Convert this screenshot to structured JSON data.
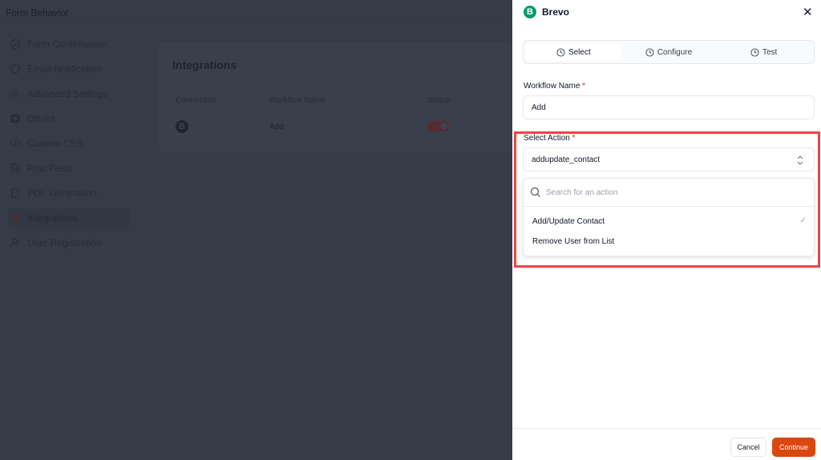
{
  "background": {
    "header_title": "Form Behavior",
    "sidebar": [
      {
        "label": "Form Confirmation",
        "icon": "check-circle-icon"
      },
      {
        "label": "Email Notification",
        "icon": "shield-icon"
      },
      {
        "label": "Advanced Settings",
        "icon": "gear-icon"
      },
      {
        "label": "Ottokit",
        "icon": "ottokit-icon"
      },
      {
        "label": "Custom CSS",
        "icon": "code-icon"
      },
      {
        "label": "Post Feed",
        "icon": "document-icon"
      },
      {
        "label": "PDF Generation",
        "icon": "file-icon"
      },
      {
        "label": "Integrations",
        "icon": "chip-icon",
        "active": true
      },
      {
        "label": "User Registration",
        "icon": "user-plus-icon"
      }
    ],
    "integrations": {
      "title": "Integrations",
      "columns": [
        "Connection",
        "Workflow Name",
        "Status"
      ],
      "rows": [
        {
          "connection_logo": "B",
          "workflow_name": "Add",
          "status_enabled": true
        }
      ]
    }
  },
  "panel": {
    "logo": "B",
    "title": "Brevo",
    "brand_color": "#0b996e",
    "tabs": [
      {
        "label": "Select",
        "active": true
      },
      {
        "label": "Configure"
      },
      {
        "label": "Test"
      }
    ],
    "workflow_name": {
      "label": "Workflow Name",
      "required": "*",
      "value": "Add"
    },
    "select_action": {
      "label": "Select Action",
      "required": "*",
      "value": "addupdate_contact",
      "search_placeholder": "Search for an action",
      "options": [
        {
          "label": "Add/Update Contact",
          "selected": true
        },
        {
          "label": "Remove User from List"
        }
      ]
    },
    "footer": {
      "cancel": "Cancel",
      "continue": "Continue"
    },
    "accent_color": "#d9480f",
    "highlight_color": "#ef4444"
  }
}
